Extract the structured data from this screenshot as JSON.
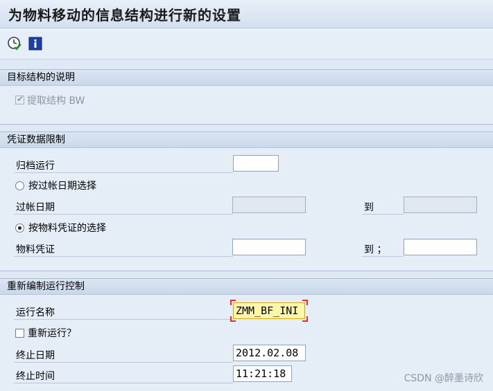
{
  "window": {
    "title": "为物料移动的信息结构进行新的设置"
  },
  "toolbar": {
    "execute_icon": "execute-clock-icon",
    "info_icon": "info-icon"
  },
  "section1": {
    "header": "目标结构的说明",
    "checkbox_label": "提取结构 BW",
    "checkbox_checked": true
  },
  "section2": {
    "header": "凭证数据限制",
    "archive_run_label": "归档运行",
    "archive_run_value": "",
    "radio_posting_date_label": "按过帐日期选择",
    "posting_date_label": "过帐日期",
    "posting_date_from": "",
    "to_label_1": "到",
    "posting_date_to": "",
    "radio_material_doc_label": "按物料凭证的选择",
    "material_doc_label": "物料凭证",
    "material_doc_from": "",
    "to_label_2": "到 ；",
    "material_doc_to": "",
    "selected_radio": "material_doc"
  },
  "section3": {
    "header": "重新编制运行控制",
    "run_name_label": "运行名称",
    "run_name_value": "ZMM_BF_INI",
    "rerun_label": "重新运行？",
    "rerun_checked": false,
    "end_date_label": "终止日期",
    "end_date_value": "2012.02.08",
    "end_time_label": "终止时间",
    "end_time_value": "11:21:18"
  },
  "watermark": "CSDN @醉墨诗欣"
}
